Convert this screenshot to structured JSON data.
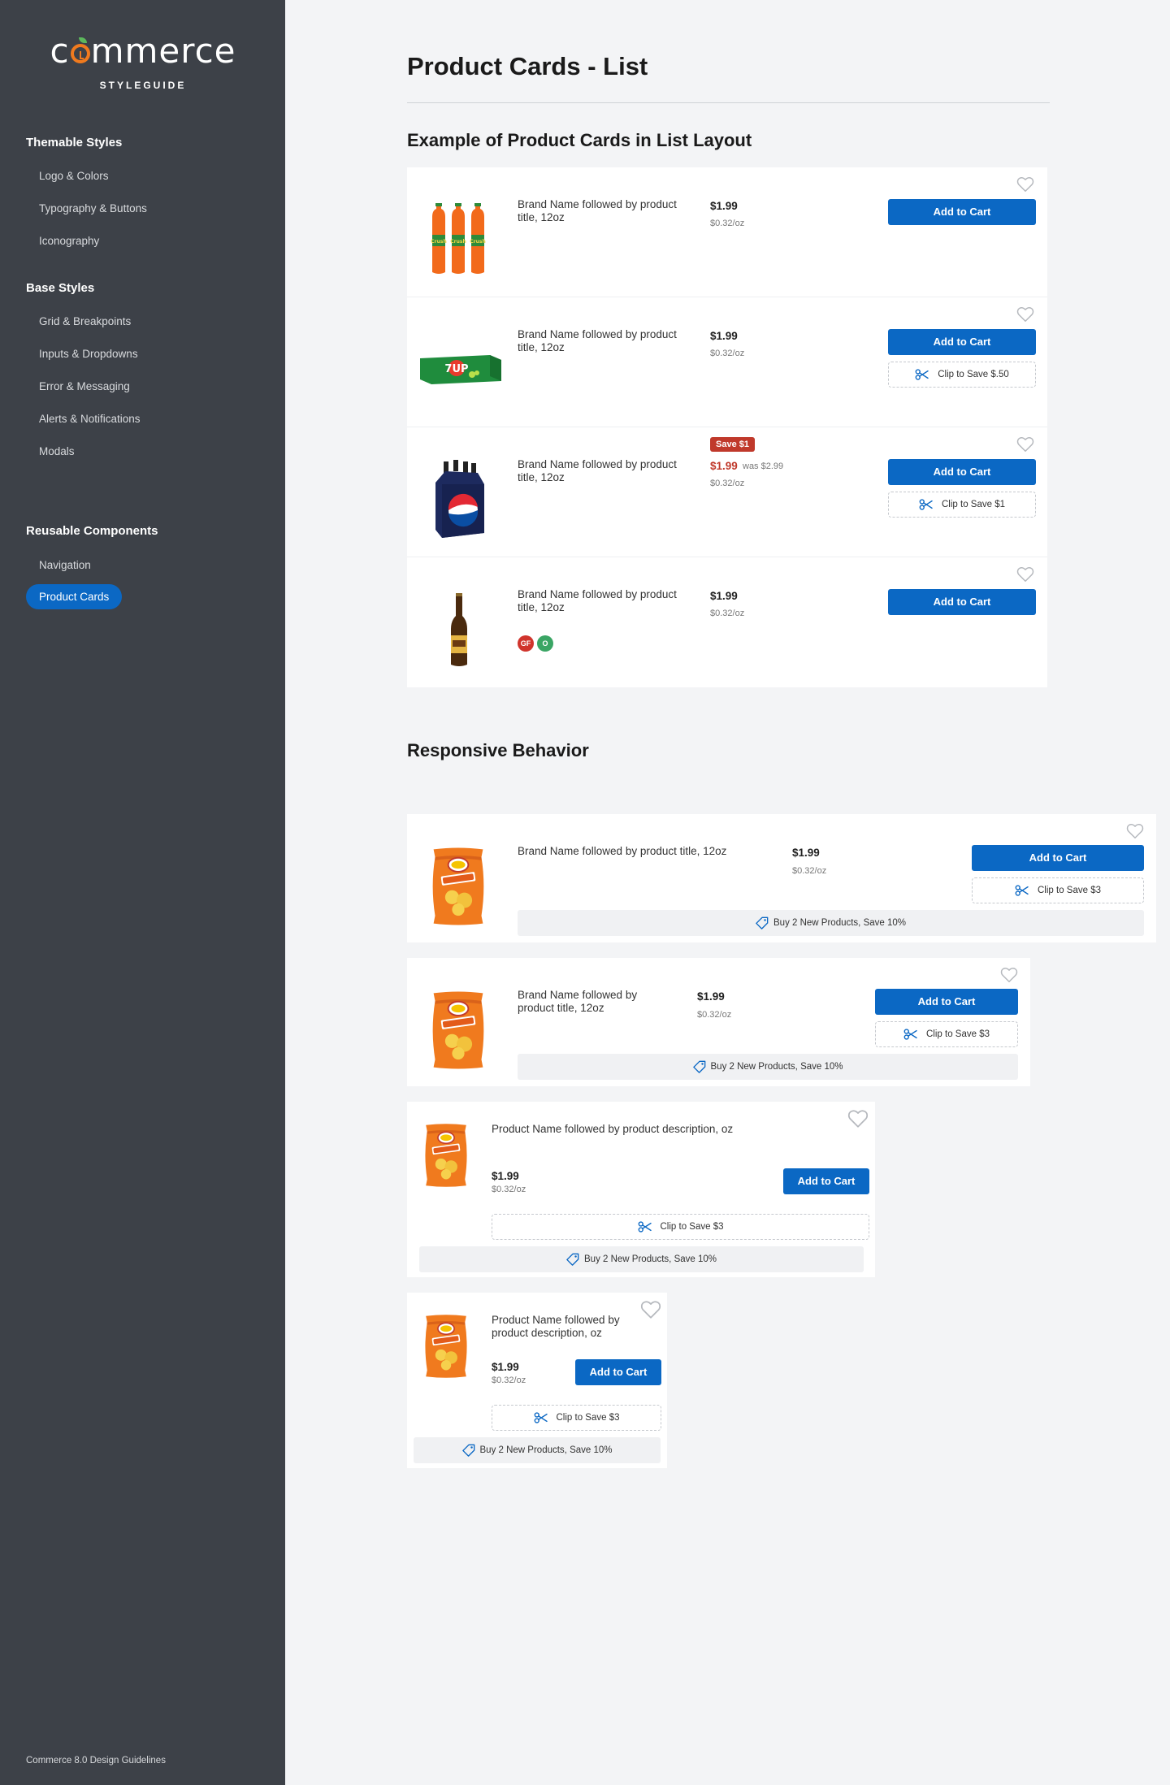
{
  "sidebar": {
    "logo_word_pre": "c",
    "logo_word_post": "mmerce",
    "logo_sub": "STYLEGUIDE",
    "sections": [
      {
        "heading": "Themable Styles",
        "items": [
          "Logo & Colors",
          "Typography & Buttons",
          "Iconography"
        ]
      },
      {
        "heading": "Base Styles",
        "items": [
          "Grid & Breakpoints",
          "Inputs & Dropdowns",
          "Error & Messaging",
          "Alerts & Notifications",
          "Modals"
        ]
      },
      {
        "heading": "Reusable Components",
        "items": [
          "Navigation",
          "Product Cards"
        ]
      }
    ],
    "active_item": "Product Cards",
    "footer": "Commerce 8.0 Design Guidelines"
  },
  "main": {
    "title": "Product Cards - List",
    "list_heading": "Example of Product Cards in List Layout",
    "responsive_heading": "Responsive Behavior"
  },
  "list_cards": [
    {
      "product": "orange-soda",
      "title": "Brand Name followed by product title, 12oz",
      "price": "$1.99",
      "unit": "$0.32/oz",
      "cart_label": "Add to Cart"
    },
    {
      "product": "7up-pack",
      "title": "Brand Name followed by product title, 12oz",
      "price": "$1.99",
      "unit": "$0.32/oz",
      "cart_label": "Add to Cart",
      "clip_label": "Clip to Save $.50"
    },
    {
      "product": "pepsi-4pack",
      "title": "Brand Name followed by product title, 12oz",
      "badge": "Save $1",
      "price": "$1.99",
      "was": "was $2.99",
      "unit": "$0.32/oz",
      "cart_label": "Add to Cart",
      "clip_label": "Clip to Save $1"
    },
    {
      "product": "beer-bottle",
      "title": "Brand Name followed by product title, 12oz",
      "price": "$1.99",
      "unit": "$0.32/oz",
      "cart_label": "Add to Cart",
      "diet_tags": [
        "GF",
        "O"
      ]
    }
  ],
  "responsive_cards": [
    {
      "title": "Brand Name followed by product title, 12oz",
      "price": "$1.99",
      "unit": "$0.32/oz",
      "cart_label": "Add to Cart",
      "clip_label": "Clip to Save $3",
      "promo": "Buy 2 New Products, Save 10%"
    },
    {
      "title": "Brand Name followed by product title, 12oz",
      "price": "$1.99",
      "unit": "$0.32/oz",
      "cart_label": "Add to Cart",
      "clip_label": "Clip to Save $3",
      "promo": "Buy 2 New Products, Save 10%"
    },
    {
      "title": "Product Name followed by product description, oz",
      "price": "$1.99",
      "unit": "$0.32/oz",
      "cart_label": "Add to Cart",
      "clip_label": "Clip to Save $3",
      "promo": "Buy 2 New Products, Save 10%"
    },
    {
      "title": "Product Name followed by product description, oz",
      "price": "$1.99",
      "unit": "$0.32/oz",
      "cart_label": "Add to Cart",
      "clip_label": "Clip to Save $3",
      "promo": "Buy 2 New Products, Save 10%"
    }
  ],
  "colors": {
    "primary": "#0b68c4",
    "sidebar": "#3d4148",
    "sale": "#c0392b",
    "brand_orange": "#f07a1e"
  },
  "icons": [
    "heart-icon",
    "scissors-icon",
    "tag-icon"
  ]
}
